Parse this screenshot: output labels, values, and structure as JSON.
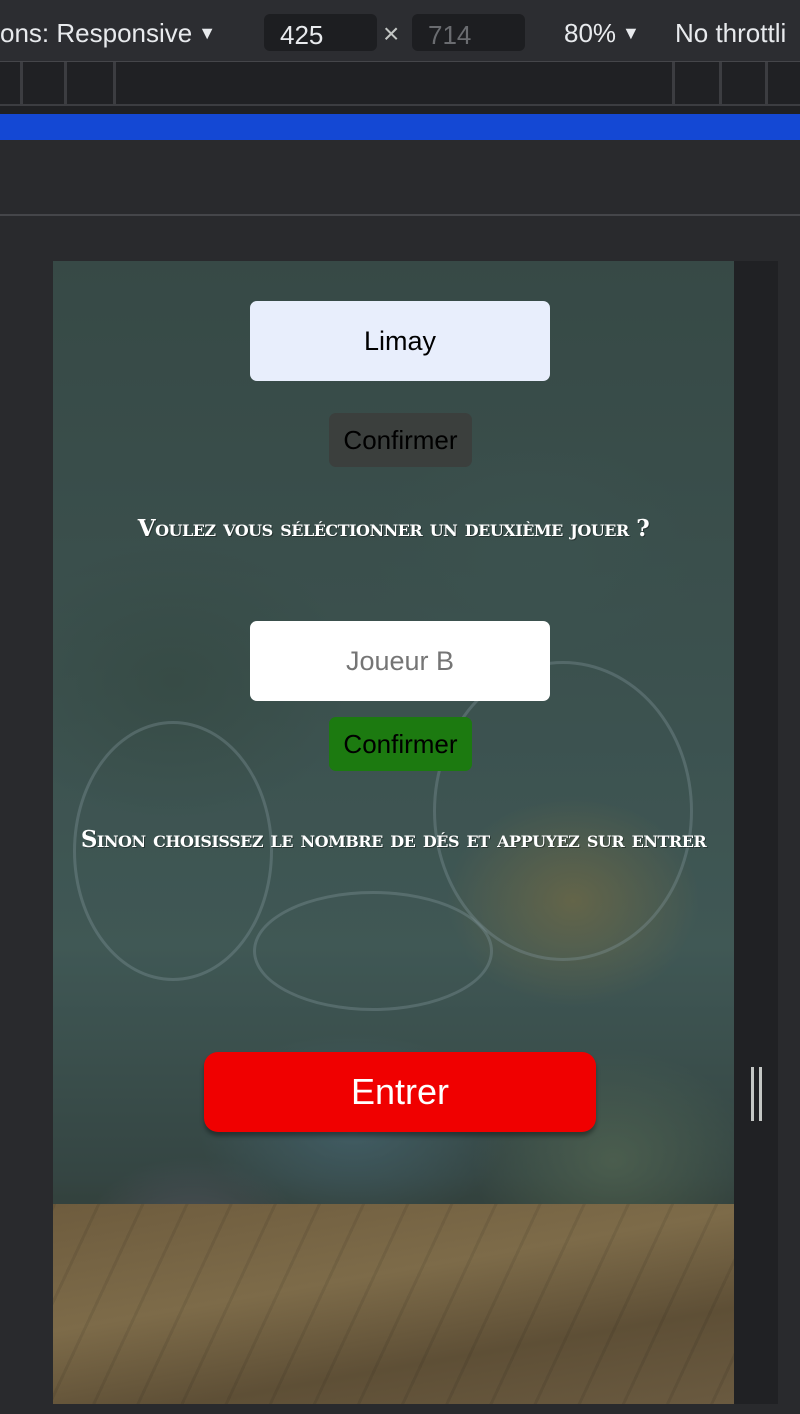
{
  "devtools": {
    "dimensions_label": "ons: Responsive",
    "width_value": "425",
    "height_placeholder": "714",
    "times_sign": "×",
    "zoom": "80%",
    "throttling": "No throttli"
  },
  "game": {
    "player1_value": "Limay",
    "confirm1_label": "Confirmer",
    "question_second_player": "Voulez vous séléctionner un deuxième jouer ?",
    "player2_placeholder": "Joueur B",
    "confirm2_label": "Confirmer",
    "instruction": "Sinon choisissez le nombre de dés et appuyez sur entrer",
    "enter_label": "Entrer"
  },
  "colors": {
    "media_bar": "#1448d4",
    "confirm1_bg": "#3b3f3d",
    "confirm2_bg": "#1c7a10",
    "enter_bg": "#f00000",
    "player1_bg": "#e8eefc"
  }
}
